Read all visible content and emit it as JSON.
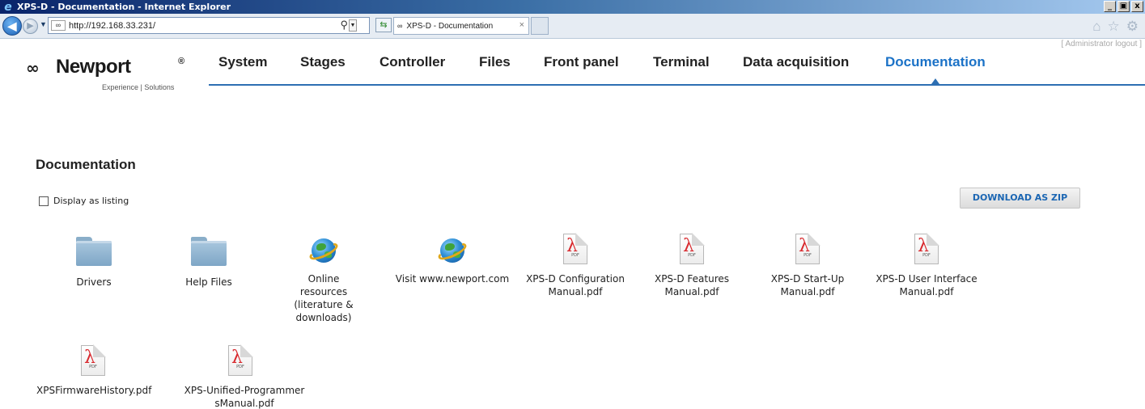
{
  "window": {
    "title": "XPS-D - Documentation - Internet Explorer",
    "controls": [
      "_",
      "▣",
      "x"
    ]
  },
  "browser": {
    "address": "http://192.168.33.231/",
    "tab_title": "XPS-D - Documentation",
    "tab_close": "×"
  },
  "site": {
    "admin_logout": "[ Administrator logout ]",
    "logo_name": "Newport",
    "logo_reg": "®",
    "logo_tagline": "Experience | Solutions",
    "nav": [
      {
        "label": "System"
      },
      {
        "label": "Stages"
      },
      {
        "label": "Controller"
      },
      {
        "label": "Files"
      },
      {
        "label": "Front panel"
      },
      {
        "label": "Terminal"
      },
      {
        "label": "Data acquisition"
      },
      {
        "label": "Documentation",
        "active": true
      }
    ]
  },
  "content": {
    "title": "Documentation",
    "display_listing_label": "Display as listing",
    "display_listing_checked": false,
    "download_zip_label": "DOWNLOAD AS ZIP",
    "items": [
      {
        "label": "Drivers",
        "icon": "folder-icon"
      },
      {
        "label": "Help Files",
        "icon": "folder-icon"
      },
      {
        "label": "Online resources (literature & downloads)",
        "icon": "globe-icon"
      },
      {
        "label": "Visit www.newport.com",
        "icon": "globe-icon"
      },
      {
        "label": "XPS-D Configuration Manual.pdf",
        "icon": "pdf-icon"
      },
      {
        "label": "XPS-D Features Manual.pdf",
        "icon": "pdf-icon"
      },
      {
        "label": "XPS-D Start-Up Manual.pdf",
        "icon": "pdf-icon"
      },
      {
        "label": "XPS-D User Interface Manual.pdf",
        "icon": "pdf-icon"
      },
      {
        "label": "XPSFirmwareHistory.pdf",
        "icon": "pdf-icon"
      },
      {
        "label": "XPS-Unified-ProgrammersManual.pdf",
        "icon": "pdf-icon"
      }
    ],
    "pdf_icon_text": "PDF"
  },
  "colors": {
    "accent": "#1b72c7",
    "nav_line": "#2d6fb3",
    "pdf_red": "#d8282d"
  }
}
